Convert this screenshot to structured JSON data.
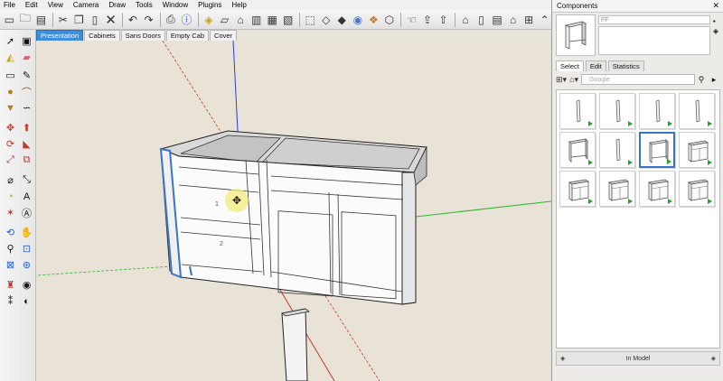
{
  "menu": [
    "File",
    "Edit",
    "View",
    "Camera",
    "Draw",
    "Tools",
    "Window",
    "Plugins",
    "Help"
  ],
  "scene_tabs": [
    {
      "label": "Presentation",
      "active": true
    },
    {
      "label": "Cabinets",
      "active": false
    },
    {
      "label": "Sans Doors",
      "active": false
    },
    {
      "label": "Empty Cab",
      "active": false
    },
    {
      "label": "Cover",
      "active": false
    }
  ],
  "toolbar_icons": [
    "new-icon",
    "open-icon",
    "save-icon",
    "cut-icon",
    "copy-icon",
    "paste-icon",
    "erase-icon",
    "undo-icon",
    "redo-icon",
    "print-icon",
    "model-info-icon",
    "iso-view-icon",
    "top-view-icon",
    "front-view-icon",
    "right-view-icon",
    "back-view-icon",
    "left-view-icon",
    "xray-icon",
    "wireframe-icon",
    "hidden-line-icon",
    "shaded-icon",
    "textured-icon",
    "monochrome-icon",
    "get-models-icon",
    "share-model-icon",
    "share-component-icon",
    "extension-icon"
  ],
  "colors": {
    "accent_tab": "#3e8edc",
    "axis_red": "#c23a2a",
    "axis_green": "#2db52d",
    "axis_blue": "#2b3fd6",
    "selection_blue": "#3b73c7",
    "viewport_bg": "#e8e3d6"
  },
  "components_panel": {
    "title": "Components",
    "name_value": "FF",
    "tabs": [
      {
        "label": "Select",
        "active": true
      },
      {
        "label": "Edit",
        "active": false
      },
      {
        "label": "Statistics",
        "active": false
      }
    ],
    "search_placeholder": "Google",
    "footer_text": "In Model",
    "selected_index": 6
  },
  "viewport": {
    "drawer_labels": [
      "1",
      "2"
    ]
  }
}
